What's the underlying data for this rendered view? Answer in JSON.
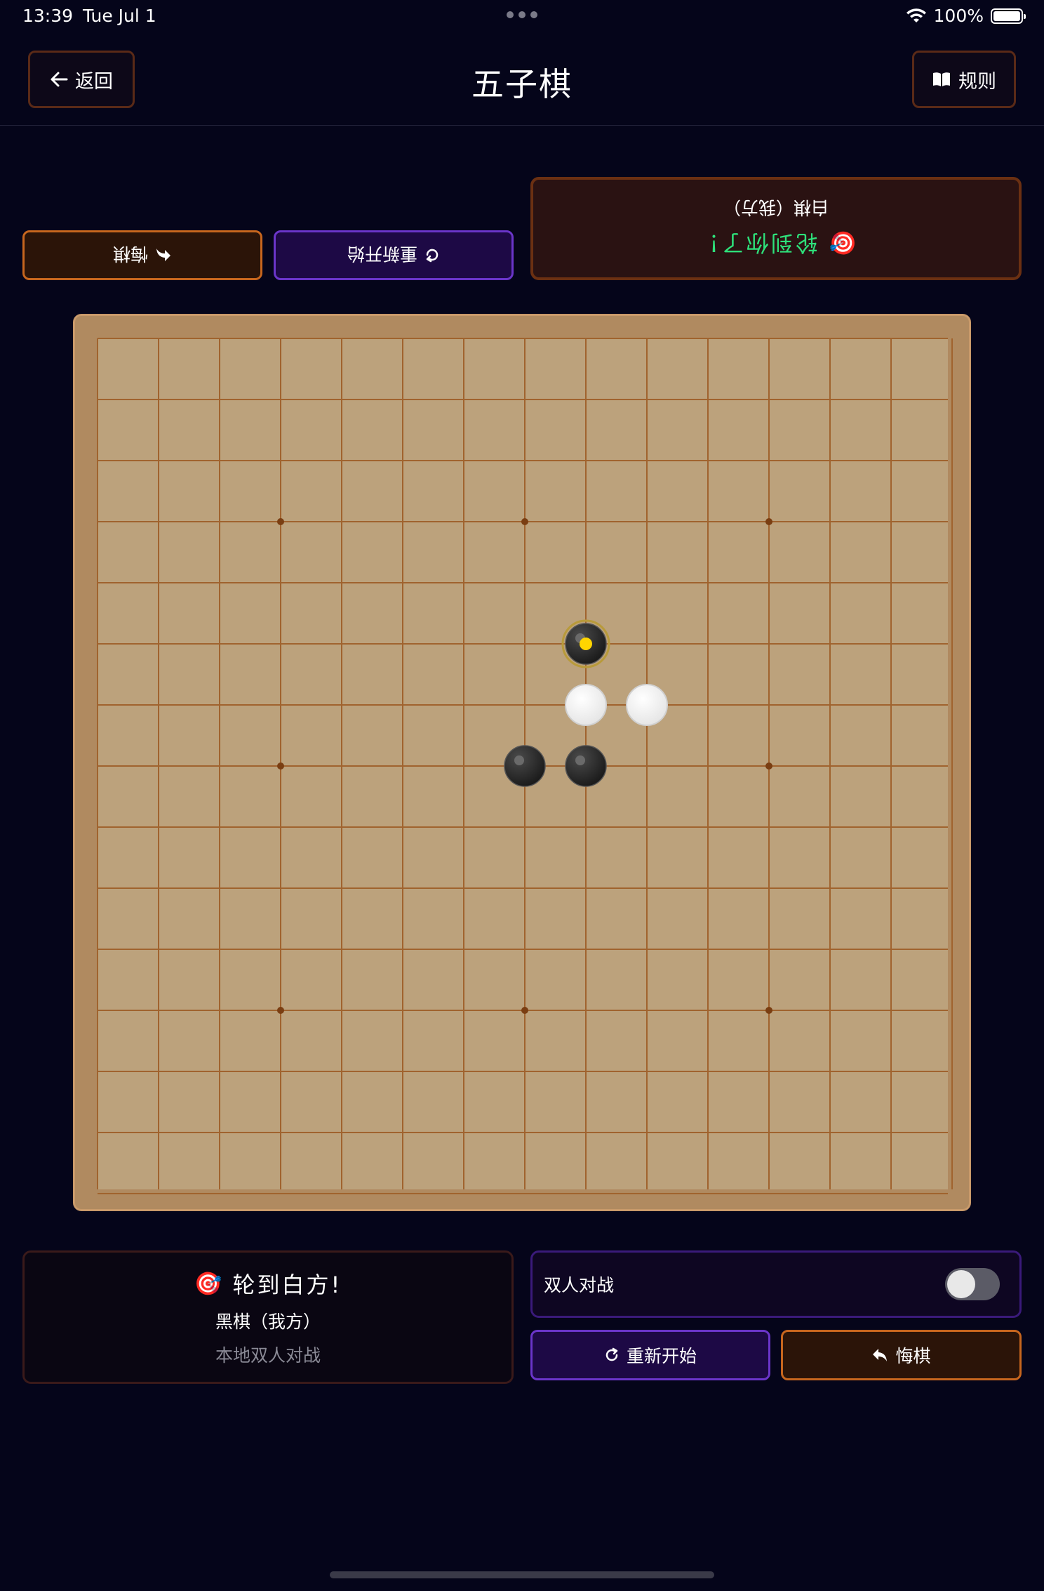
{
  "status_bar": {
    "time": "13:39",
    "date": "Tue Jul 1",
    "battery": "100%"
  },
  "header": {
    "back_label": "返回",
    "title": "五子棋",
    "rules_label": "规则"
  },
  "opponent_panel": {
    "turn_text": "轮到你了！",
    "player_text": "白棋（我方）",
    "undo_label": "悔棋",
    "restart_label": "重新开始",
    "turn_color": "#2ee07a"
  },
  "board": {
    "size": 15,
    "star_points": [
      [
        3,
        3
      ],
      [
        3,
        7
      ],
      [
        3,
        11
      ],
      [
        7,
        3
      ],
      [
        7,
        7
      ],
      [
        7,
        11
      ],
      [
        11,
        3
      ],
      [
        11,
        7
      ],
      [
        11,
        11
      ]
    ],
    "stones": [
      {
        "row": 5,
        "col": 8,
        "color": "black",
        "last_move": true
      },
      {
        "row": 6,
        "col": 8,
        "color": "white"
      },
      {
        "row": 6,
        "col": 9,
        "color": "white"
      },
      {
        "row": 7,
        "col": 7,
        "color": "black"
      },
      {
        "row": 7,
        "col": 8,
        "color": "black"
      }
    ],
    "colors": {
      "wood": "#bca27c",
      "line": "#a0632e",
      "frame": "#b08a60",
      "last_move_marker": "#ffd500"
    }
  },
  "player_panel": {
    "turn_text": "轮到白方!",
    "player_text": "黑棋（我方）",
    "mode_text": "本地双人对战"
  },
  "controls": {
    "mode_label": "双人对战",
    "mode_enabled": false,
    "restart_label": "重新开始",
    "undo_label": "悔棋"
  },
  "icons": {
    "back": "arrow-left-icon",
    "rules": "book-icon",
    "turn": "target-dart-icon",
    "restart": "refresh-icon",
    "undo": "undo-arrow-icon"
  }
}
